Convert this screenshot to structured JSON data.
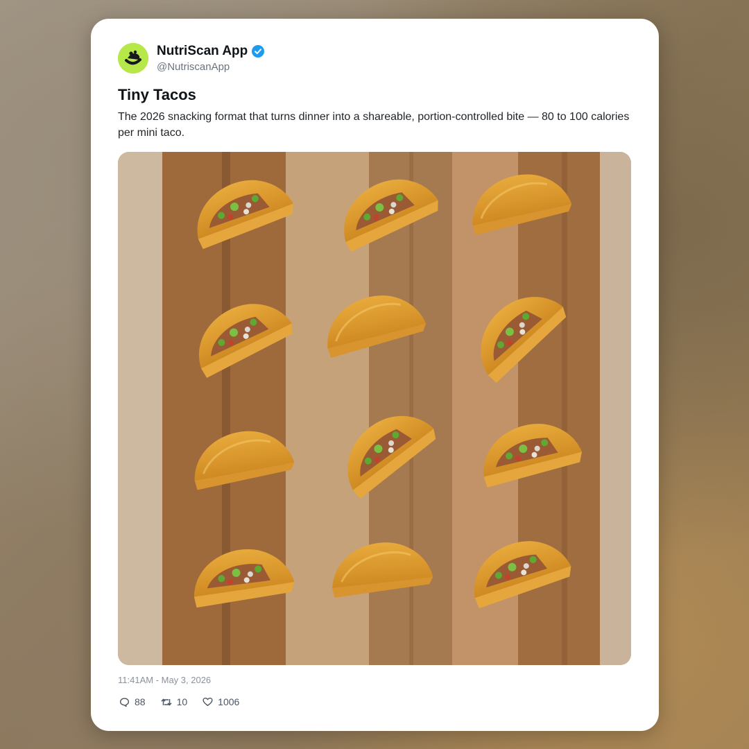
{
  "post": {
    "account": {
      "display_name": "NutriScan App",
      "handle": "@NutriscanApp",
      "verified_icon": "verified-badge-icon",
      "avatar_icon": "nutriscan-logo-icon",
      "accent_color": "#b6e84a",
      "verified_color": "#1d9bf0"
    },
    "title": "Tiny Tacos",
    "text": "The 2026 snacking format that turns dinner into a shareable, portion-controlled bite — 80 to 100 calories per mini taco.",
    "image": {
      "subject": "twelve mini taco shells arranged in a 3-by-4 grid on a wooden cutting board"
    },
    "timestamp": "11:41AM - May 3, 2026",
    "stats": {
      "replies": "88",
      "reposts": "10",
      "likes": "1006"
    }
  }
}
